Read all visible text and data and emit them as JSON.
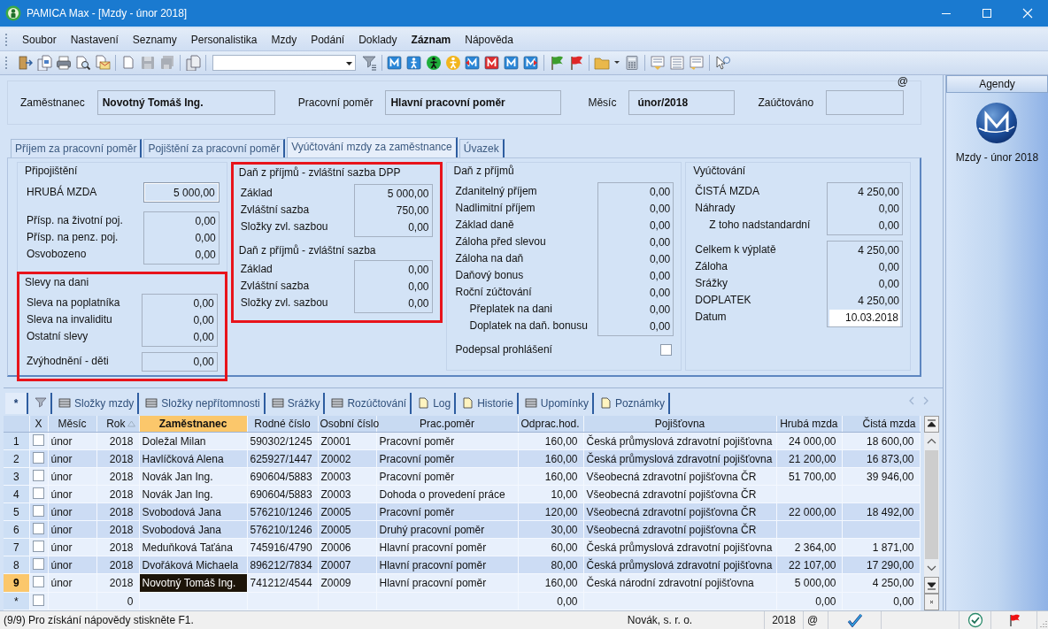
{
  "window": {
    "title": "PAMICA Max - [Mzdy - únor 2018]"
  },
  "menu": [
    {
      "label": "Soubor",
      "bold": false
    },
    {
      "label": "Nastavení",
      "bold": false
    },
    {
      "label": "Seznamy",
      "bold": false
    },
    {
      "label": "Personalistika",
      "bold": false
    },
    {
      "label": "Mzdy",
      "bold": false
    },
    {
      "label": "Podání",
      "bold": false
    },
    {
      "label": "Doklady",
      "bold": false
    },
    {
      "label": "Záznam",
      "bold": true
    },
    {
      "label": "Nápověda",
      "bold": false
    }
  ],
  "header": {
    "at_mark": "@",
    "fields": [
      {
        "label": "Zaměstnanec",
        "value": "Novotný Tomáš Ing."
      },
      {
        "label": "Pracovní poměr",
        "value": "Hlavní pracovní poměr"
      },
      {
        "label": "Měsíc",
        "value": "únor/2018"
      },
      {
        "label": "Zaúčtováno"
      }
    ]
  },
  "tabs": [
    {
      "label": "Příjem za pracovní poměr",
      "selected": false
    },
    {
      "label": "Pojištění za pracovní poměr",
      "selected": false
    },
    {
      "label": "Vyúčtování mzdy za zaměstnance",
      "selected": true
    },
    {
      "label": "Úvazek",
      "selected": false
    }
  ],
  "columns": [
    {
      "sections": [
        {
          "title": "Připojištění",
          "highlighted": false,
          "blocks": [
            {
              "kind": "emphasis",
              "rows": [
                {
                  "label": "HRUBÁ MZDA",
                  "value": "5 000,00"
                }
              ]
            },
            {
              "kind": "plain",
              "rows": [
                {
                  "label": "Přísp. na životní poj.",
                  "value": "0,00"
                },
                {
                  "label": "Přísp. na penz. poj.",
                  "value": "0,00"
                },
                {
                  "label": "Osvobozeno",
                  "value": "0,00"
                }
              ]
            }
          ]
        },
        {
          "title": "Slevy na dani",
          "highlighted": true,
          "blocks": [
            {
              "kind": "plain",
              "rows": [
                {
                  "label": "Sleva na poplatníka",
                  "value": "0,00"
                },
                {
                  "label": "Sleva na invaliditu",
                  "value": "0,00"
                },
                {
                  "label": "Ostatní slevy",
                  "value": "0,00"
                }
              ]
            },
            {
              "kind": "plain",
              "rows": [
                {
                  "label": "Zvýhodnění - děti",
                  "value": "0,00"
                }
              ]
            }
          ]
        }
      ]
    },
    {
      "sections": [
        {
          "title": "Daň z příjmů - zvláštní sazba DPP",
          "highlighted": true,
          "blocks": [
            {
              "kind": "plain",
              "rows": [
                {
                  "label": "Základ",
                  "value": "5 000,00"
                },
                {
                  "label": "Zvláštní sazba",
                  "value": "750,00"
                },
                {
                  "label": "Složky zvl. sazbou",
                  "value": "0,00"
                }
              ]
            },
            {
              "kind": "plain",
              "heading": "Daň z příjmů - zvláštní sazba",
              "rows": [
                {
                  "label": "Základ",
                  "value": "0,00"
                },
                {
                  "label": "Zvláštní sazba",
                  "value": "0,00"
                },
                {
                  "label": "Složky zvl. sazbou",
                  "value": "0,00"
                }
              ]
            }
          ]
        }
      ]
    },
    {
      "sections": [
        {
          "title": "Daň z příjmů",
          "highlighted": false,
          "blocks": [
            {
              "kind": "plain",
              "rows": [
                {
                  "label": "Zdanitelný příjem",
                  "value": "0,00"
                },
                {
                  "label": "Nadlimitní příjem",
                  "value": "0,00"
                },
                {
                  "label": "Základ daně",
                  "value": "0,00"
                },
                {
                  "label": "Záloha před slevou",
                  "value": "0,00"
                },
                {
                  "label": "Záloha na daň",
                  "value": "0,00"
                },
                {
                  "label": "Daňový bonus",
                  "value": "0,00"
                },
                {
                  "label": "Roční zúčtování",
                  "value": "0,00"
                },
                {
                  "label": "Přeplatek na dani",
                  "value": "0,00",
                  "indented": true
                },
                {
                  "label": "Doplatek na daň. bonusu",
                  "value": "0,00",
                  "indented": true
                }
              ]
            },
            {
              "kind": "checkbox",
              "rows": [
                {
                  "label": "Podepsal prohlášení",
                  "checked": false
                }
              ]
            }
          ]
        }
      ]
    },
    {
      "sections": [
        {
          "title": "Vyúčtování",
          "highlighted": false,
          "blocks": [
            {
              "kind": "plain",
              "rows": [
                {
                  "label": "ČISTÁ MZDA",
                  "value": "4 250,00"
                },
                {
                  "label": "Náhrady",
                  "value": "0,00"
                },
                {
                  "label": "Z toho nadstandardní",
                  "value": "0,00",
                  "indented": true
                }
              ]
            },
            {
              "kind": "plain",
              "rows": [
                {
                  "label": "Celkem k výplatě",
                  "value": "4 250,00"
                },
                {
                  "label": "Záloha",
                  "value": "0,00"
                },
                {
                  "label": "Srážky",
                  "value": "0,00"
                },
                {
                  "label": "DOPLATEK",
                  "value": "4 250,00"
                },
                {
                  "label": "Datum",
                  "value": "10.03.2018",
                  "kind": "input"
                }
              ]
            }
          ]
        }
      ]
    }
  ],
  "agendy": {
    "title": "Agendy",
    "items": [
      {
        "label": "Mzdy - únor 2018"
      }
    ]
  },
  "grid_tabs": [
    {
      "kind": "text",
      "label": "*",
      "selected": true
    },
    {
      "kind": "filter",
      "selected": false
    },
    {
      "kind": "grid",
      "label": "Složky mzdy",
      "selected": false
    },
    {
      "kind": "grid",
      "label": "Složky nepřítomnosti",
      "selected": false
    },
    {
      "kind": "grid",
      "label": "Srážky",
      "selected": false
    },
    {
      "kind": "grid",
      "label": "Rozúčtování",
      "selected": false
    },
    {
      "kind": "page",
      "label": "Log",
      "selected": false
    },
    {
      "kind": "page",
      "label": "Historie",
      "selected": false
    },
    {
      "kind": "grid",
      "label": "Upomínky",
      "selected": false
    },
    {
      "kind": "page",
      "label": "Poznámky",
      "selected": false
    }
  ],
  "table": {
    "checkbox_column": "X",
    "columns": [
      {
        "label": "Měsíc",
        "selected": false,
        "sorted": false
      },
      {
        "label": "Rok",
        "selected": false,
        "sorted": true
      },
      {
        "label": "Zaměstnanec",
        "selected": true,
        "sorted": false
      },
      {
        "label": "Rodné číslo",
        "selected": false,
        "sorted": false
      },
      {
        "label": "Osobní číslo",
        "selected": false,
        "sorted": false
      },
      {
        "label": "Prac.poměr",
        "selected": false,
        "sorted": false
      },
      {
        "label": "Odprac.hod.",
        "selected": false,
        "sorted": false
      },
      {
        "label": "Pojišťovna",
        "selected": false,
        "sorted": false
      },
      {
        "label": "Hrubá mzda",
        "selected": false,
        "sorted": false
      },
      {
        "label": "Čistá mzda",
        "selected": false,
        "sorted": false
      }
    ],
    "rows": [
      {
        "marker": "1",
        "checked": false,
        "selected": false,
        "shaded": false,
        "cells": [
          "únor",
          "2018",
          "Doležal Milan",
          "590302/1245",
          "Z0001",
          "Pracovní poměr",
          "160,00",
          "Česká průmyslová zdravotní pojišťovna",
          "24 000,00",
          "18 600,00"
        ]
      },
      {
        "marker": "2",
        "checked": false,
        "selected": false,
        "shaded": true,
        "cells": [
          "únor",
          "2018",
          "Havlíčková Alena",
          "625927/1447",
          "Z0002",
          "Pracovní poměr",
          "160,00",
          "Česká průmyslová zdravotní pojišťovna",
          "21 200,00",
          "16 873,00"
        ]
      },
      {
        "marker": "3",
        "checked": false,
        "selected": false,
        "shaded": false,
        "cells": [
          "únor",
          "2018",
          "Novák Jan Ing.",
          "690604/5883",
          "Z0003",
          "Pracovní poměr",
          "160,00",
          "Všeobecná zdravotní pojišťovna ČR",
          "51 700,00",
          "39 946,00"
        ]
      },
      {
        "marker": "4",
        "checked": false,
        "selected": false,
        "shaded": false,
        "cells": [
          "únor",
          "2018",
          "Novák Jan Ing.",
          "690604/5883",
          "Z0003",
          "Dohoda o provedení práce",
          "10,00",
          "Všeobecná zdravotní pojišťovna ČR",
          null,
          null
        ]
      },
      {
        "marker": "5",
        "checked": false,
        "selected": false,
        "shaded": true,
        "cells": [
          "únor",
          "2018",
          "Svobodová Jana",
          "576210/1246",
          "Z0005",
          "Pracovní poměr",
          "120,00",
          "Všeobecná zdravotní pojišťovna ČR",
          "22 000,00",
          "18 492,00"
        ]
      },
      {
        "marker": "6",
        "checked": false,
        "selected": false,
        "shaded": true,
        "cells": [
          "únor",
          "2018",
          "Svobodová Jana",
          "576210/1246",
          "Z0005",
          "Druhý pracovní poměr",
          "30,00",
          "Všeobecná zdravotní pojišťovna ČR",
          null,
          null
        ]
      },
      {
        "marker": "7",
        "checked": false,
        "selected": false,
        "shaded": false,
        "cells": [
          "únor",
          "2018",
          "Meduňková Taťána",
          "745916/4790",
          "Z0006",
          "Hlavní pracovní poměr",
          "60,00",
          "Česká průmyslová zdravotní pojišťovna",
          "2 364,00",
          "1 871,00"
        ]
      },
      {
        "marker": "8",
        "checked": false,
        "selected": false,
        "shaded": true,
        "cells": [
          "únor",
          "2018",
          "Dvořáková Michaela",
          "896212/7834",
          "Z0007",
          "Hlavní pracovní poměr",
          "80,00",
          "Česká průmyslová zdravotní pojišťovna",
          "22 107,00",
          "17 290,00"
        ]
      },
      {
        "marker": "9",
        "checked": false,
        "selected": true,
        "shaded": false,
        "cells": [
          "únor",
          "2018",
          "Novotný Tomáš Ing.",
          "741212/4544",
          "Z0009",
          "Hlavní pracovní poměr",
          "160,00",
          "Česká národní zdravotní pojišťovna",
          "5 000,00",
          "4 250,00"
        ]
      },
      {
        "marker": "*",
        "checked": false,
        "selected": false,
        "shaded": false,
        "cells": [
          null,
          "0",
          null,
          null,
          null,
          null,
          "0,00",
          null,
          "0,00",
          "0,00"
        ]
      }
    ]
  },
  "status_bar": {
    "text": "(9/9) Pro získání nápovědy stiskněte F1.",
    "company": "Novák, s. r. o.",
    "year": "2018",
    "at_mark": "@"
  }
}
